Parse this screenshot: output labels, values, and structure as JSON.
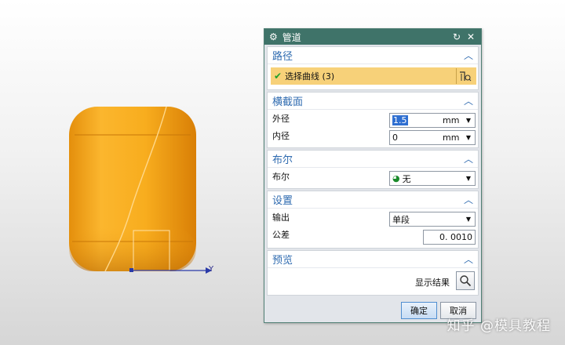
{
  "viewport": {
    "axis_y_label": "Y",
    "model_color": "#f6a81c",
    "background_top": "#ffffff",
    "background_bottom": "#d6d6d6"
  },
  "dialog": {
    "title": "管道",
    "icons": {
      "settings": "gear-icon",
      "reset": "reset-icon",
      "close": "close-icon"
    },
    "sections": {
      "path": {
        "header": "路径",
        "selection_label": "选择曲线 (3)"
      },
      "cross_section": {
        "header": "横截面",
        "outer_label": "外径",
        "outer_value": "1.5",
        "outer_unit": "mm",
        "inner_label": "内径",
        "inner_value": "0",
        "inner_unit": "mm"
      },
      "boolean": {
        "header": "布尔",
        "label": "布尔",
        "value": "无"
      },
      "settings": {
        "header": "设置",
        "output_label": "输出",
        "output_value": "单段",
        "tolerance_label": "公差",
        "tolerance_value": "0. 0010"
      },
      "preview": {
        "header": "预览",
        "show_result_label": "显示结果"
      }
    },
    "buttons": {
      "ok": "确定",
      "cancel": "取消"
    },
    "colors": {
      "titlebar": "#3f7369",
      "section_header": "#2f6bb0",
      "selection_bg": "#f7d179"
    }
  },
  "watermark": "知乎 @模具教程"
}
